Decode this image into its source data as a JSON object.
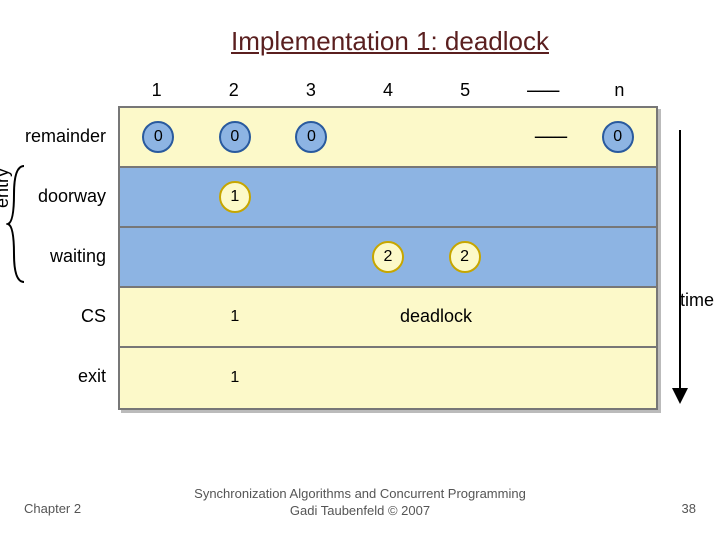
{
  "title": "Implementation 1: deadlock",
  "columns": [
    "1",
    "2",
    "3",
    "4",
    "5",
    "--------",
    "n"
  ],
  "row_labels": {
    "remainder": "remainder",
    "doorway": "doorway",
    "waiting": "waiting",
    "cs": "CS",
    "exit": "exit"
  },
  "entry_label": "entry",
  "rows": {
    "remainder": {
      "c1": "0",
      "c2": "0",
      "c3": "0",
      "dash": "--------",
      "cn": "0"
    },
    "doorway": {
      "c2": "1"
    },
    "waiting": {
      "c4": "2",
      "c5": "2"
    },
    "cs": {
      "c2": "1",
      "deadlock": "deadlock"
    },
    "exit": {
      "c2": "1"
    }
  },
  "time_label": "time",
  "footer": {
    "left": "Chapter 2",
    "center_l1": "Synchronization Algorithms and Concurrent Programming",
    "center_l2": "Gadi Taubenfeld © 2007",
    "page": "38"
  }
}
